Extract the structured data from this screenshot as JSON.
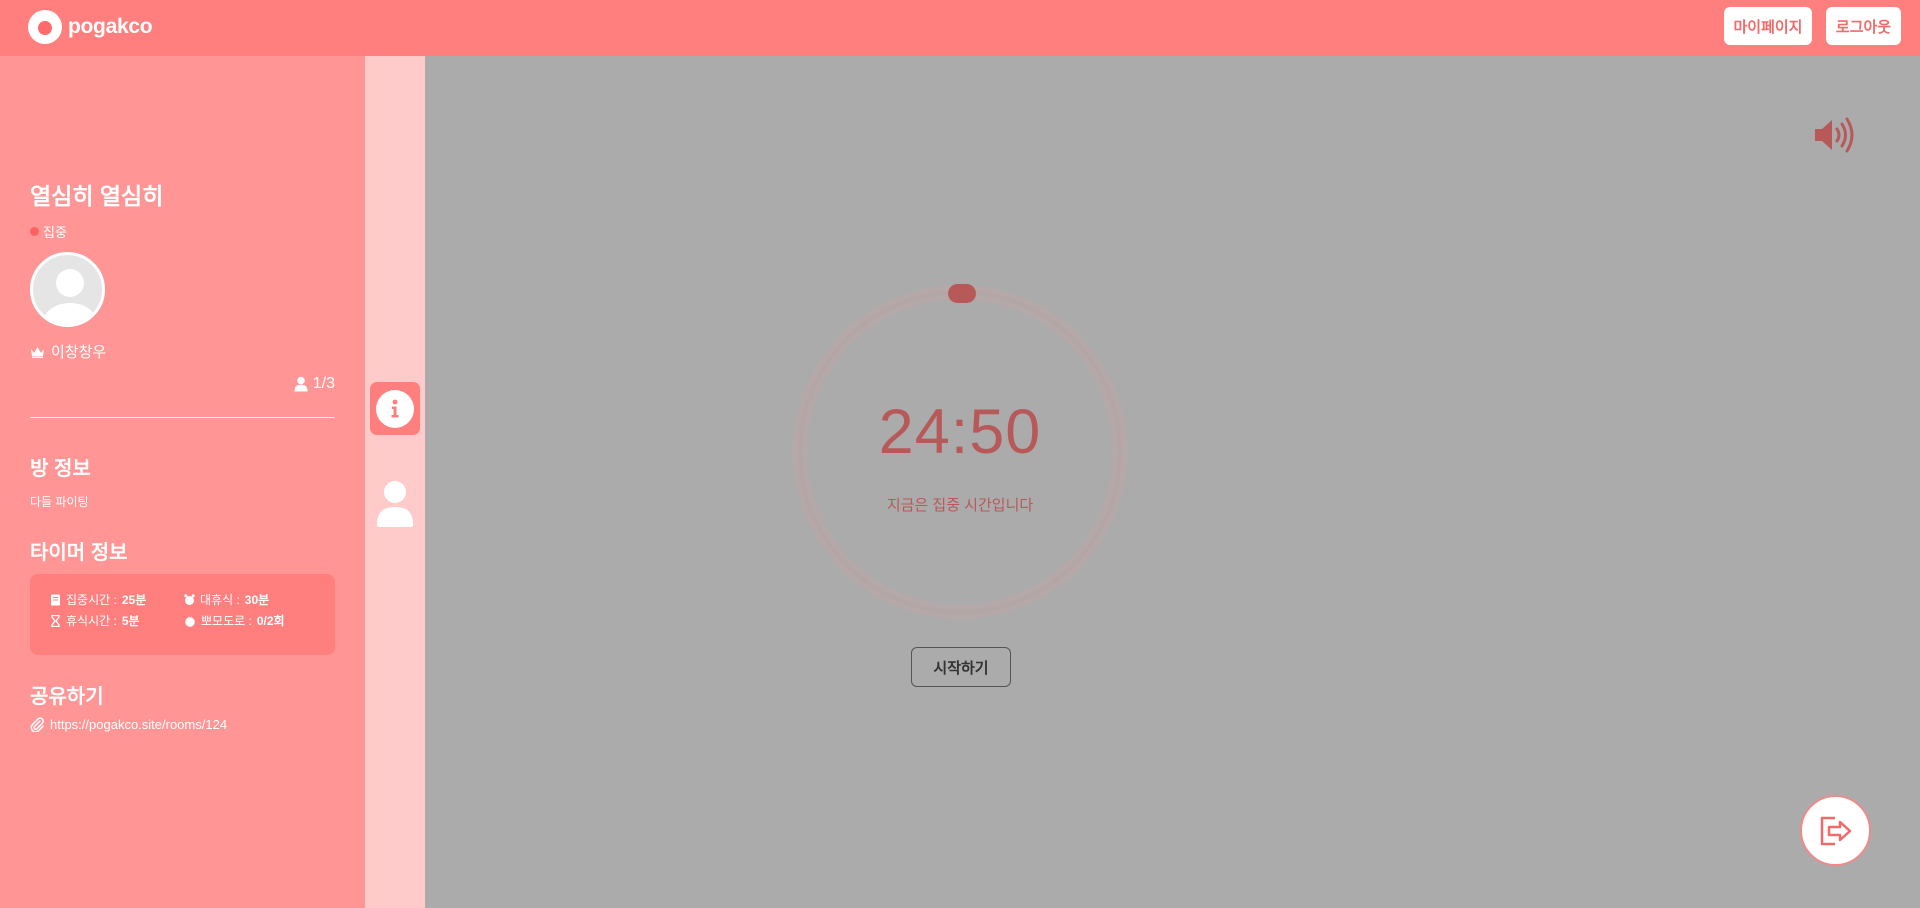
{
  "header": {
    "logo_text": "pogakco",
    "mypage_label": "마이페이지",
    "logout_label": "로그아웃"
  },
  "sidebar": {
    "room_title": "열심히 열심히",
    "status": "집중",
    "host_name": "이창창우",
    "participant_count": "1/3",
    "room_info_title": "방 정보",
    "room_info_desc": "다들 파이팅",
    "timer_info_title": "타이머 정보",
    "timer_info": {
      "focus_label": "집중시간 : ",
      "focus_value": "25분",
      "long_break_label": "대휴식 : ",
      "long_break_value": "30분",
      "break_label": "휴식시간 : ",
      "break_value": "5분",
      "pomodoro_label": "뽀모도로 : ",
      "pomodoro_value": "0/2회"
    },
    "share_title": "공유하기",
    "share_url": "https://pogakco.site/rooms/124"
  },
  "main": {
    "time": "24:50",
    "status_text": "지금은 집중 시간입니다",
    "start_label": "시작하기"
  },
  "colors": {
    "header": "#ff7e7e",
    "sidebar": "#ff9595",
    "rail": "#ffcaca",
    "main_bg": "#ababac",
    "accent": "#b85959"
  },
  "icons": [
    "logo-tomato-icon",
    "speaker-icon",
    "crown-icon",
    "user-count-icon",
    "info-icon",
    "user-icon",
    "book-icon",
    "alarm-icon",
    "hourglass-icon",
    "tomato-icon",
    "paperclip-icon",
    "exit-icon"
  ]
}
